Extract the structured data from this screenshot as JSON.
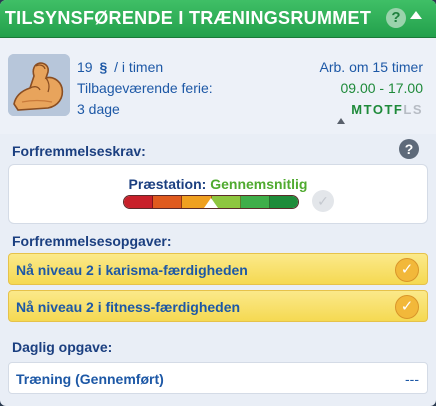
{
  "header": {
    "title": "TILSYNSFØRENDE I TRÆNINGSRUMMET",
    "help_glyph": "?",
    "collapse_icon": "caret-up-icon",
    "color": "#2bb057"
  },
  "career_info": {
    "avatar_icon": "flexed-arm-icon",
    "wage_amount": "19",
    "wage_currency": "§",
    "wage_unit": "/ i timen",
    "vacation_label": "Tilbageværende ferie:",
    "vacation_value": "3 dage",
    "work_in": "Arb. om 15 timer",
    "hours": "09.00 - 17.00",
    "days": [
      {
        "label": "M",
        "active": true
      },
      {
        "label": "T",
        "active": true
      },
      {
        "label": "O",
        "active": true
      },
      {
        "label": "T",
        "active": true
      },
      {
        "label": "F",
        "active": true
      },
      {
        "label": "L",
        "active": false
      },
      {
        "label": "S",
        "active": false
      }
    ]
  },
  "promotion": {
    "heading": "Forfremmelseskrav:",
    "help_glyph": "?",
    "performance_label": "Præstation:",
    "performance_value": "Gennemsnitlig",
    "performance_level": 0.5,
    "bar_colors": [
      "#c8202a",
      "#e05a1e",
      "#f0a020",
      "#8ec63f",
      "#3fae49",
      "#1f8c3a"
    ],
    "check_glyph": "✓"
  },
  "tasks": {
    "heading": "Forfremmelsesopgaver:",
    "items": [
      {
        "label": "Nå niveau 2 i karisma-færdigheden",
        "done_glyph": "✓"
      },
      {
        "label": "Nå niveau 2 i fitness-færdigheden",
        "done_glyph": "✓"
      }
    ]
  },
  "daily": {
    "heading": "Daglig opgave:",
    "label": "Træning (Gennemført)",
    "status": "---"
  }
}
